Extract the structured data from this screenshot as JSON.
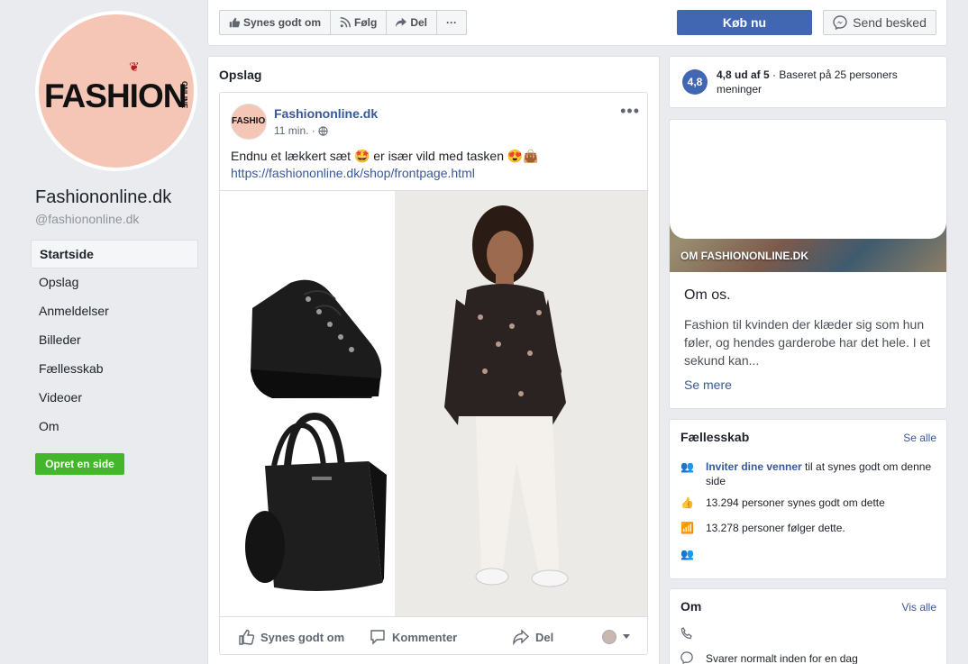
{
  "profile": {
    "logo_text": "FASHION",
    "logo_sub": "ONLINE",
    "name": "Fashiononline.dk",
    "handle": "@fashiononline.dk"
  },
  "nav": {
    "items": [
      {
        "label": "Startside"
      },
      {
        "label": "Opslag"
      },
      {
        "label": "Anmeldelser"
      },
      {
        "label": "Billeder"
      },
      {
        "label": "Fællesskab"
      },
      {
        "label": "Videoer"
      },
      {
        "label": "Om"
      }
    ],
    "create_page": "Opret en side"
  },
  "topbar": {
    "like": "Synes godt om",
    "follow": "Følg",
    "share": "Del",
    "more": "···",
    "buy": "Køb nu",
    "message": "Send besked"
  },
  "posts": {
    "title": "Opslag",
    "post": {
      "avatar_text": "FASHION",
      "author": "Fashiononline.dk",
      "time": "11 min. ·",
      "text": "Endnu et lækkert sæt 🤩 er især vild med tasken 😍👜",
      "link": "https://fashiononline.dk/shop/frontpage.html",
      "actions": {
        "like": "Synes godt om",
        "comment": "Kommenter",
        "share": "Del"
      }
    }
  },
  "rating": {
    "score": "4,8",
    "text_bold": "4,8 ud af 5",
    "text_rest": " · Baseret på 25 personers meninger"
  },
  "about": {
    "cover_label": "OM FASHIONONLINE.DK",
    "heading": "Om os.",
    "description": "Fashion til kvinden der klæder sig som hun føler, og hendes garderobe har det hele. I et sekund kan...",
    "more": "Se mere"
  },
  "community": {
    "title": "Fællesskab",
    "see_all": "Se alle",
    "invite_link": "Inviter dine venner",
    "invite_rest": " til at synes godt om denne side",
    "likes": "13.294 personer synes godt om dette",
    "follows": "13.278 personer følger dette."
  },
  "om": {
    "title": "Om",
    "see_all": "Vis alle",
    "response": "Svarer normalt inden for en dag"
  },
  "colors": {
    "brand_blue": "#4267b2",
    "link_blue": "#385898",
    "green": "#42b72a",
    "background": "#e9ebee"
  }
}
